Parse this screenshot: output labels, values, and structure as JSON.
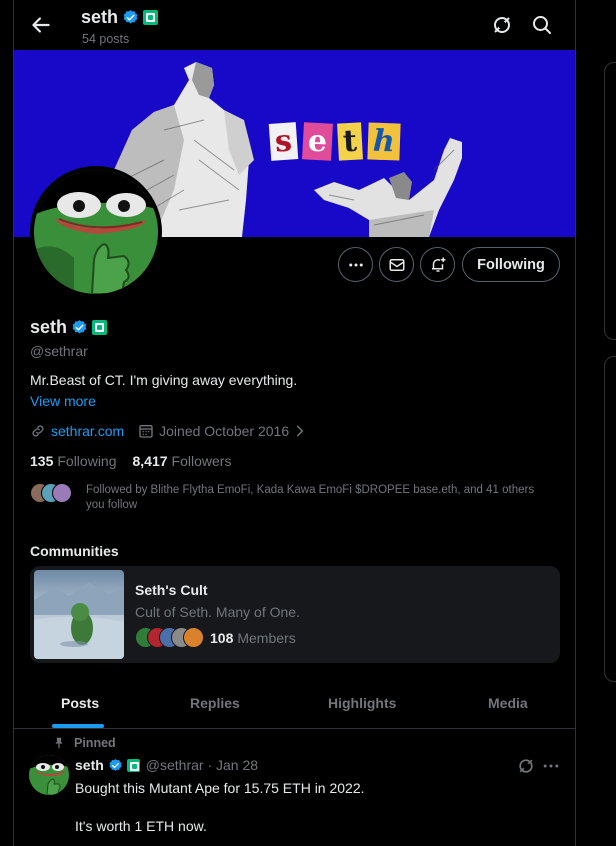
{
  "header": {
    "name": "seth",
    "posts_count": "54 posts"
  },
  "banner": {
    "letters": [
      "s",
      "e",
      "t",
      "h"
    ],
    "background": "#1809c8"
  },
  "actions": {
    "more_icon": "ellipsis-icon",
    "message_icon": "mail-icon",
    "notify_icon": "bell-plus-icon",
    "following_label": "Following"
  },
  "profile": {
    "name": "seth",
    "handle": "@sethrar",
    "bio": "Mr.Beast of CT. I'm giving away everything.",
    "view_more": "View more",
    "website": "sethrar.com",
    "joined": "Joined October 2016",
    "following_count": "135",
    "following_label": "Following",
    "followers_count": "8,417",
    "followers_label": "Followers",
    "followed_by": "Followed by Blithe Flytha EmoFi, Kada Kawa EmoFi $DROPEE base.eth, and 41 others you follow"
  },
  "communities": {
    "title": "Communities",
    "card": {
      "name": "Seth's Cult",
      "description": "Cult of Seth. Many of One.",
      "member_count": "108",
      "member_label": "Members"
    }
  },
  "tabs": [
    {
      "label": "Posts"
    },
    {
      "label": "Replies"
    },
    {
      "label": "Highlights"
    },
    {
      "label": "Media"
    }
  ],
  "post": {
    "pinned_label": "Pinned",
    "name": "seth",
    "handle_date": "@sethrar · Jan 28",
    "text": "Bought this Mutant Ape for 15.75 ETH in 2022.\n\nIt's worth 1 ETH now."
  },
  "colors": {
    "accent": "#1d9bf0",
    "verified": "#1d9bf0",
    "affiliate_badge": "#00ba7c"
  }
}
